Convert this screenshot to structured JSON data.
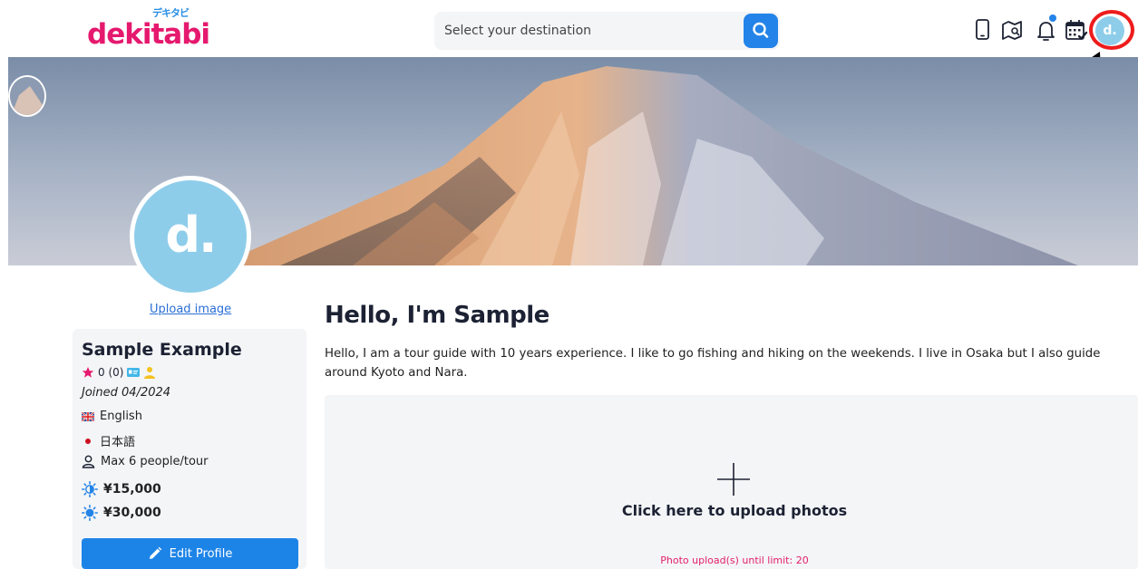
{
  "header": {
    "logo_text": "dekitabi",
    "logo_kana": "デキタビ",
    "search_placeholder": "Select your destination",
    "icons": [
      "search-icon",
      "phone-icon",
      "map-icon",
      "bell-icon",
      "calendar-check-icon"
    ],
    "avatar_initial": "d."
  },
  "profile": {
    "avatar_initial": "d.",
    "upload_image_label": "Upload image"
  },
  "card": {
    "name": "Sample Example",
    "rating": "0 (0)",
    "joined": "Joined 04/2024",
    "languages": [
      {
        "flag": "gb",
        "label": "English"
      },
      {
        "flag": "jp",
        "label": "日本語"
      }
    ],
    "max_people": "Max 6 people/tour",
    "prices": [
      {
        "icon": "half-day-icon",
        "value": "¥15,000"
      },
      {
        "icon": "full-day-icon",
        "value": "¥30,000"
      }
    ],
    "edit_button": "Edit Profile"
  },
  "main": {
    "heading": "Hello, I'm Sample",
    "bio": "Hello, I am a tour guide with 10 years experience. I like to go fishing and hiking on the weekends. I live in Osaka but I also guide around Kyoto and Nara.",
    "upload_cta": "Click here to upload photos",
    "upload_limit": "Photo upload(s) until limit: 20"
  },
  "colors": {
    "brand_pink": "#e5196e",
    "accent_blue": "#2383e8",
    "highlight_red": "#ee1c1c"
  }
}
